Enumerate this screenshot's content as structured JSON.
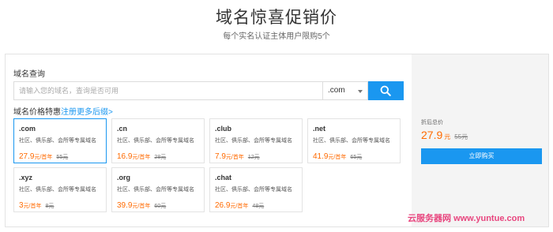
{
  "header": {
    "title": "域名惊喜促销价",
    "subtitle": "每个实名认证主体用户限购5个"
  },
  "search": {
    "label": "域名查询",
    "placeholder": "请输入您的域名，查询是否可用",
    "tld_selected": ".com",
    "button_icon": "search-icon"
  },
  "pricing": {
    "title": "域名价格特惠",
    "more_link": "注册更多后缀>",
    "cards": [
      {
        "tld": ".com",
        "desc": "社区、俱乐部、会所等专属域名",
        "price": "27.9",
        "unit": "元/首年",
        "original": "55元"
      },
      {
        "tld": ".cn",
        "desc": "社区、俱乐部、会所等专属域名",
        "price": "16.9",
        "unit": "元/首年",
        "original": "28元"
      },
      {
        "tld": ".club",
        "desc": "社区、俱乐部、会所等专属域名",
        "price": "7.9",
        "unit": "元/首年",
        "original": "12元"
      },
      {
        "tld": ".net",
        "desc": "社区、俱乐部、会所等专属域名",
        "price": "41.9",
        "unit": "元/首年",
        "original": "65元"
      },
      {
        "tld": ".xyz",
        "desc": "社区、俱乐部、会所等专属域名",
        "price": "3",
        "unit": "元/首年",
        "original": "8元"
      },
      {
        "tld": ".org",
        "desc": "社区、俱乐部、会所等专属域名",
        "price": "39.9",
        "unit": "元/首年",
        "original": "60元"
      },
      {
        "tld": ".chat",
        "desc": "社区、俱乐部、会所等专属域名",
        "price": "26.9",
        "unit": "元/首年",
        "original": "48元"
      }
    ]
  },
  "summary": {
    "label": "折后总价",
    "price": "27.9",
    "currency": "元",
    "original": "55元",
    "buy_label": "立即购买"
  },
  "watermark": {
    "cn": "云服务器网",
    "url": "www.yuntue.com"
  },
  "colors": {
    "accent": "#1a97f0",
    "price": "#ff6a00",
    "watermark": "#e8457e"
  }
}
